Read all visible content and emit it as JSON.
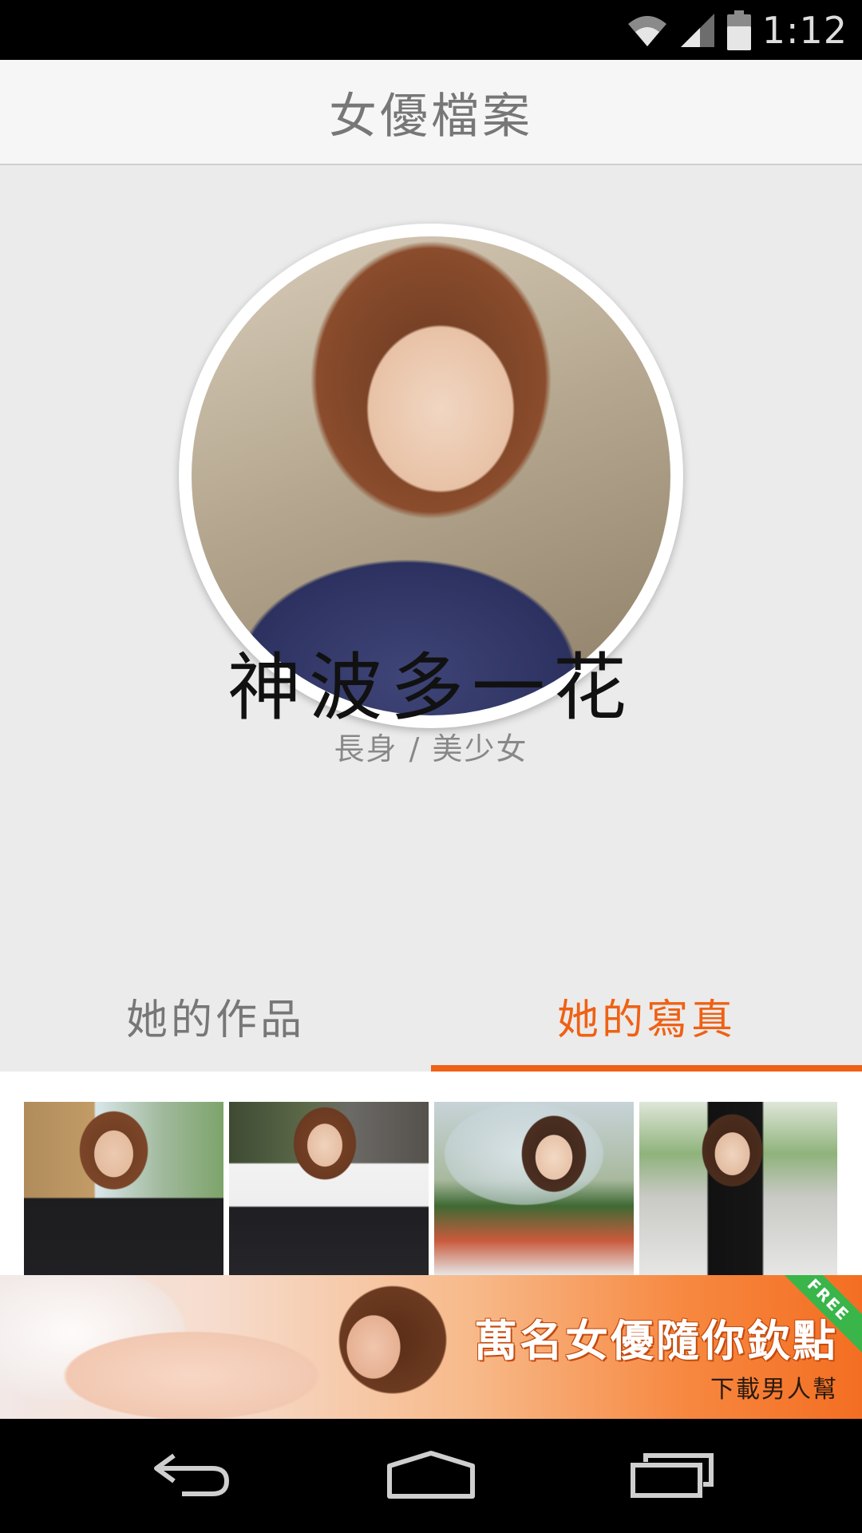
{
  "status_bar": {
    "time": "1:12",
    "icons": [
      "wifi-icon",
      "signal-icon",
      "battery-icon"
    ]
  },
  "header": {
    "title": "女優檔案"
  },
  "profile": {
    "name": "神波多一花",
    "tags": "長身 / 美少女"
  },
  "tabs": [
    {
      "label": "她的作品",
      "active": false
    },
    {
      "label": "她的寫真",
      "active": true
    }
  ],
  "colors": {
    "accent": "#ef6114",
    "tab_inactive": "#777777",
    "background": "#ebebeb"
  },
  "photos": [
    {
      "name": "photo-thumbnail"
    },
    {
      "name": "photo-thumbnail"
    },
    {
      "name": "photo-thumbnail"
    },
    {
      "name": "photo-thumbnail"
    }
  ],
  "ad": {
    "headline": "萬名女優隨你欽點",
    "subtext": "下載男人幫",
    "ribbon": "FREE"
  },
  "nav_bar": {
    "icons": [
      "back-icon",
      "home-icon",
      "recent-apps-icon"
    ]
  }
}
